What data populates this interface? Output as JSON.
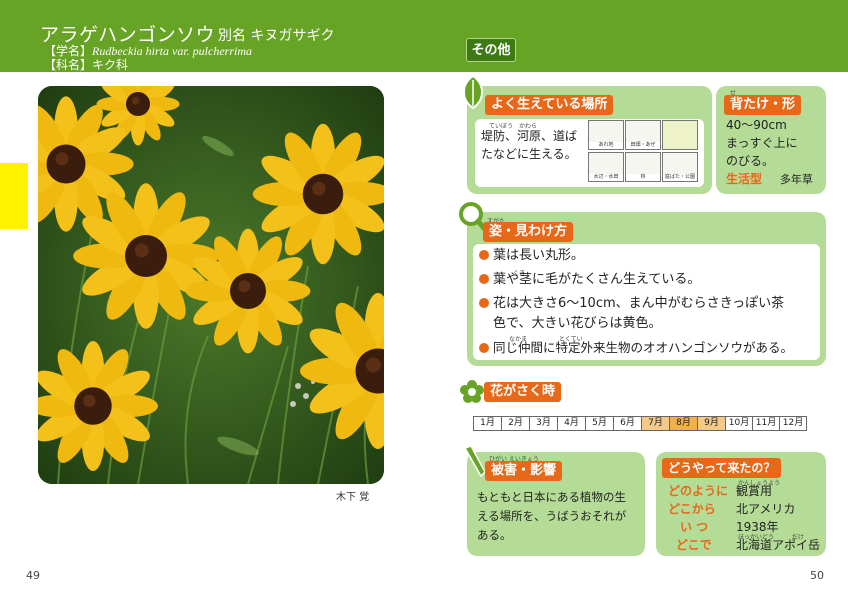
{
  "header": {
    "title": "アラゲハンゴンソウ",
    "alias": "別名 キヌガサギク",
    "scientific_prefix": "【学名】",
    "scientific_name": "Rudbeckia hirta var. pulcherrima",
    "family": "【科名】キク科",
    "section_tag": "その他"
  },
  "photo": {
    "credit": "木下 覚"
  },
  "pages": {
    "left": "49",
    "right": "50"
  },
  "habitat": {
    "label": "よく生えている場所",
    "ruby": [
      "ていぼう",
      "かわら"
    ],
    "text_line1": "堤防、河原、道ば",
    "text_line2": "たなどに生える。",
    "icons": [
      "あれ地",
      "田畑・あぜ",
      "",
      "水辺・水田",
      "林",
      "庭ばた・公園"
    ]
  },
  "height": {
    "label": "背たけ・形",
    "ruby": "せ",
    "line1": "40〜90cm",
    "line2": "まっすぐ上に",
    "line3": "のびる。",
    "life_form_label": "生活型",
    "life_form": "多年草"
  },
  "identify": {
    "label": "姿・見わけ方",
    "ruby_sugata": "すがた",
    "ruby_kuki": "くき",
    "ruby_nakama": "なかま",
    "ruby_tokutei": "とくてい",
    "bullets": [
      "葉は長い丸形。",
      "葉や茎に毛がたくさん生えている。",
      "花は大きさ6〜10cm、まん中がむらさきっぽい茶",
      "色で、大きい花びらは黄色。",
      "同じ仲間に特定外来生物のオオハンゴンソウがある。"
    ]
  },
  "bloom": {
    "label": "花がさく時",
    "months": [
      "1月",
      "2月",
      "3月",
      "4月",
      "5月",
      "6月",
      "7月",
      "8月",
      "9月",
      "10月",
      "11月",
      "12月"
    ]
  },
  "damage": {
    "label": "被害・影響",
    "ruby": "ひがい えいきょう",
    "line1": "もともと日本にある植物の生",
    "line2": "える場所を、うばうおそれが",
    "line3": "ある。"
  },
  "origin": {
    "label": "どうやって来たの？",
    "rows": [
      {
        "key": "どのように",
        "value": "観賞用",
        "ruby": "かんしょうよう"
      },
      {
        "key": "どこから",
        "value": "北アメリカ",
        "ruby": ""
      },
      {
        "key": "い つ",
        "value": "1938年",
        "ruby": ""
      },
      {
        "key": "どこで",
        "value": "北海道アポイ岳",
        "ruby": "ほっかいどう　　　だけ"
      }
    ]
  },
  "colors": {
    "header_green": "#67a324",
    "box_green": "#b5dc96",
    "label_orange": "#e8681a",
    "yellow_tab": "#fff200"
  }
}
